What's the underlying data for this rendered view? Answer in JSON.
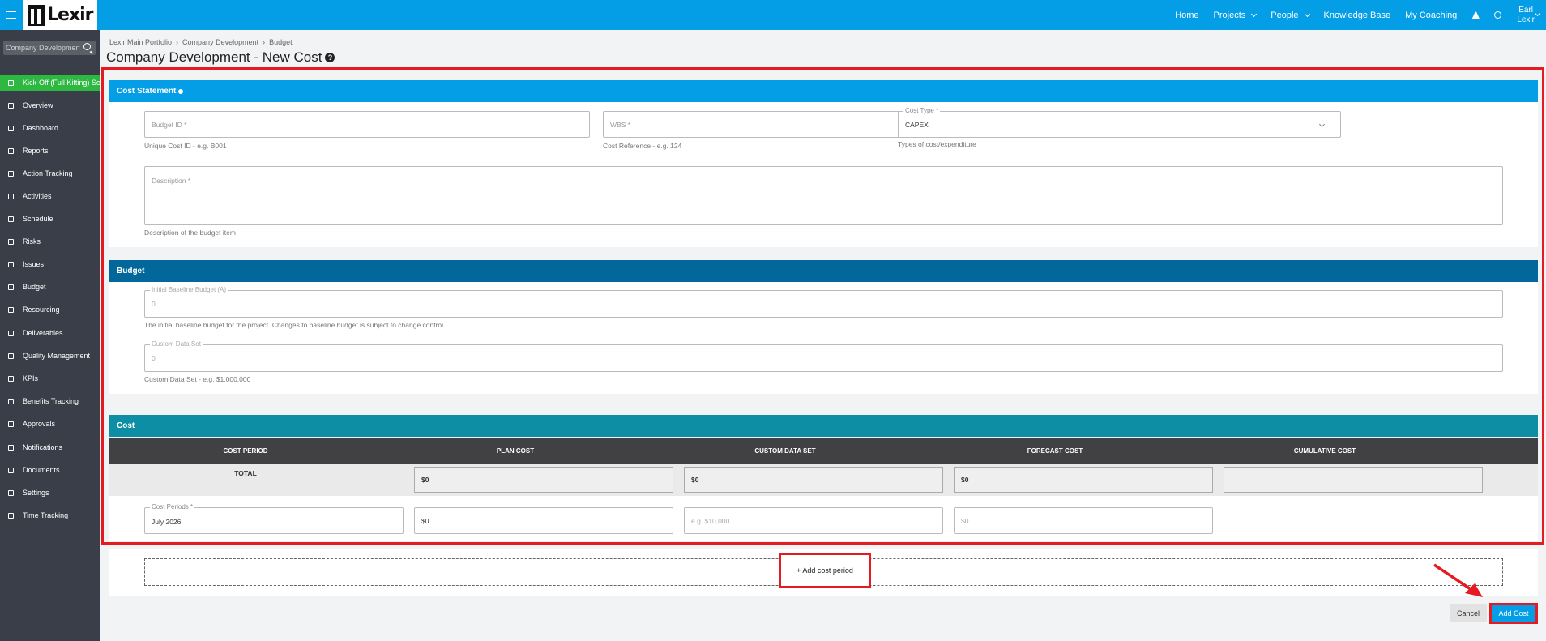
{
  "app": {
    "logo_text": "Lexir"
  },
  "topnav": {
    "home": "Home",
    "projects": "Projects",
    "people": "People",
    "knowledge_base": "Knowledge Base",
    "my_coaching": "My Coaching",
    "user_first": "Earl",
    "user_last": "Lexir"
  },
  "sidebar": {
    "search_value": "Company Development",
    "items": [
      {
        "label": "Kick-Off (Full Kitting) Setup",
        "icon": "rocket-icon"
      },
      {
        "label": "Overview",
        "icon": "list-icon"
      },
      {
        "label": "Dashboard",
        "icon": "dashboard-icon"
      },
      {
        "label": "Reports",
        "icon": "bar-chart-icon"
      },
      {
        "label": "Action Tracking",
        "icon": "crosshair-icon"
      },
      {
        "label": "Activities",
        "icon": "bookmark-icon"
      },
      {
        "label": "Schedule",
        "icon": "calendar-icon"
      },
      {
        "label": "Risks",
        "icon": "bug-icon"
      },
      {
        "label": "Issues",
        "icon": "warning-icon"
      },
      {
        "label": "Budget",
        "icon": "dollar-icon"
      },
      {
        "label": "Resourcing",
        "icon": "folder-icon"
      },
      {
        "label": "Deliverables",
        "icon": "truck-icon"
      },
      {
        "label": "Quality Management",
        "icon": "tag-icon"
      },
      {
        "label": "KPIs",
        "icon": "anchor-icon"
      },
      {
        "label": "Benefits Tracking",
        "icon": "line-chart-icon"
      },
      {
        "label": "Approvals",
        "icon": "check-circle-icon"
      },
      {
        "label": "Notifications",
        "icon": "bell-icon"
      },
      {
        "label": "Documents",
        "icon": "document-icon"
      },
      {
        "label": "Settings",
        "icon": "gear-icon"
      },
      {
        "label": "Time Tracking",
        "icon": "clock-icon"
      }
    ]
  },
  "breadcrumb": [
    "Lexir Main Portfolio",
    "Company Development",
    "Budget"
  ],
  "page_title": "Company Development - New Cost",
  "cost_statement": {
    "header": "Cost Statement",
    "budget_id": {
      "placeholder": "Budget ID *",
      "hint": "Unique Cost ID - e.g. B001"
    },
    "wbs": {
      "placeholder": "WBS *",
      "hint": "Cost Reference - e.g. 124"
    },
    "cost_type": {
      "label": "Cost Type *",
      "value": "CAPEX",
      "hint": "Types of cost/expenditure"
    },
    "description": {
      "placeholder": "Description *",
      "hint": "Description of the budget item"
    }
  },
  "budget": {
    "header": "Budget",
    "initial_baseline": {
      "label": "Initial Baseline Budget (A)",
      "value": "0",
      "hint": "The initial baseline budget for the project. Changes to baseline budget is subject to change control"
    },
    "custom_data_set": {
      "label": "Custom Data Set",
      "value": "0",
      "hint": "Custom Data Set - e.g. $1,000,000"
    }
  },
  "cost": {
    "header": "Cost",
    "columns": [
      "COST PERIOD",
      "PLAN COST",
      "CUSTOM DATA SET",
      "FORECAST COST",
      "CUMULATIVE COST"
    ],
    "total_label": "TOTAL",
    "totals": [
      "$0",
      "$0",
      "$0",
      ""
    ],
    "period_label": "Cost Periods *",
    "period_value": "July 2026",
    "plan_cost_value": "$0",
    "custom_data_placeholder": "e.g. $10,000",
    "forecast_placeholder": "$0"
  },
  "add_cost_period": "+ Add cost period",
  "actions": {
    "cancel": "Cancel",
    "add_cost": "Add Cost"
  },
  "colors": {
    "topbar": "#049ee6",
    "sidebar": "#393e48",
    "active_item": "#2db842",
    "cost_statement_header": "#049ee6",
    "budget_header": "#02679a",
    "cost_header": "#0e8ea4",
    "annotation_red": "#e41b23"
  }
}
